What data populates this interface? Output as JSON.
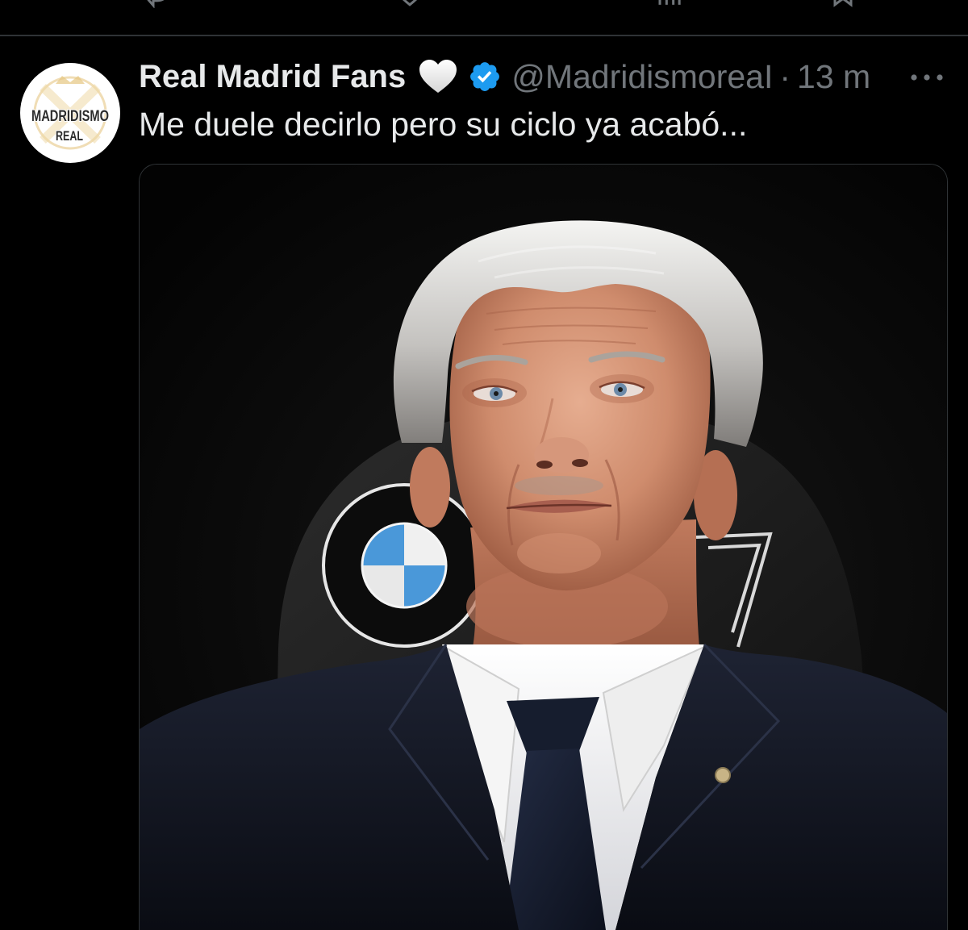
{
  "colors": {
    "background": "#000000",
    "primary_text": "#e7e9ea",
    "secondary_text": "#71767b",
    "divider": "#2f3336",
    "verified_badge": "#1d9bf0"
  },
  "previous_post": {
    "action_icons": [
      "reply-icon",
      "like-icon",
      "views-icon",
      "bookmark-icon"
    ]
  },
  "post": {
    "avatar": {
      "logo_text_line1": "MADRIDISMO",
      "logo_text_line2": "REAL"
    },
    "author_name": "Real Madrid Fans",
    "name_emoji_icon": "white-heart-icon",
    "verified_icon": "verified-badge-icon",
    "handle": "@MadridismoreaI",
    "separator": "·",
    "time": "13 m",
    "more_icon": "more-icon",
    "text": "Me duele decirlo pero su ciclo ya acabó..."
  }
}
